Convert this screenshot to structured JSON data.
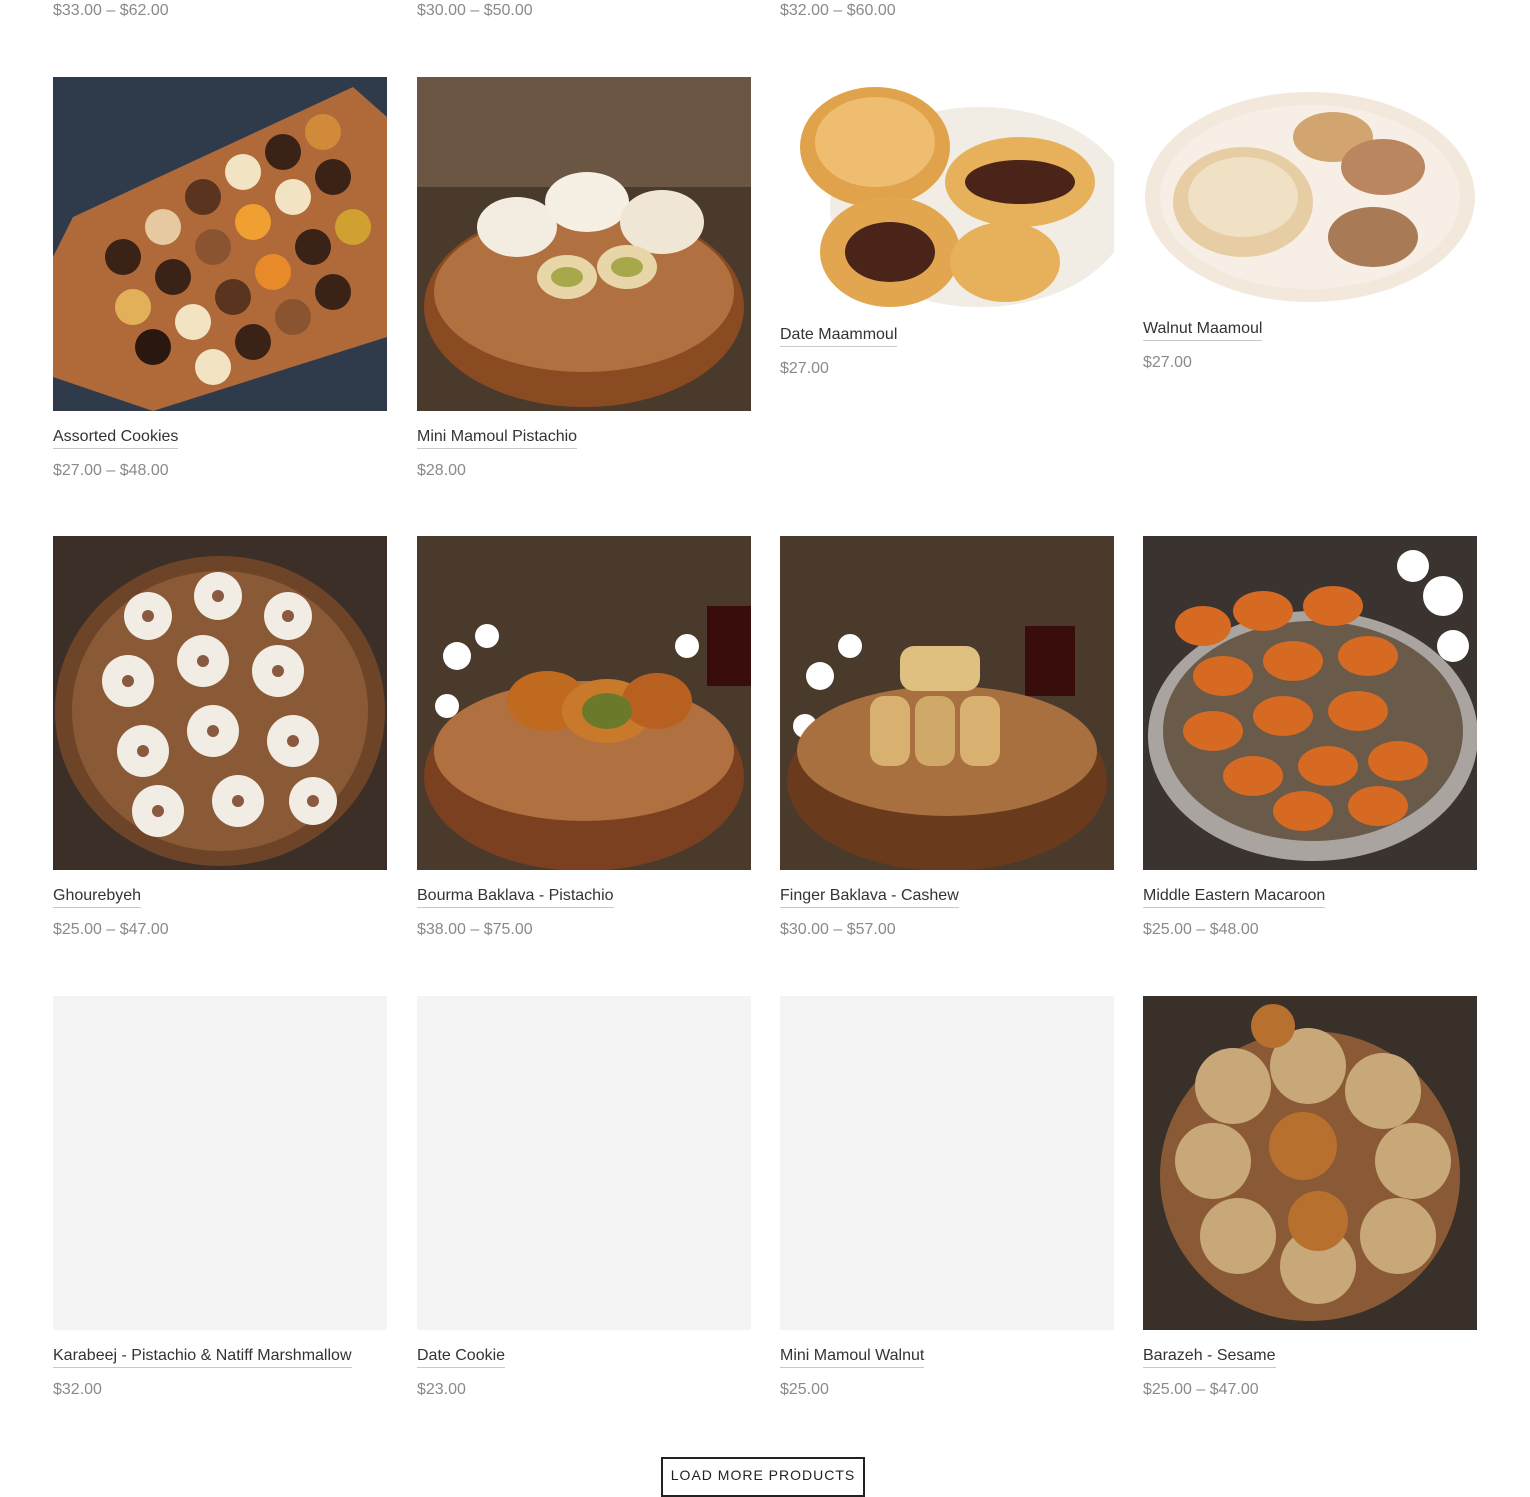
{
  "top_prices": [
    "$33.00 – $62.00",
    "$30.00 – $50.00",
    "$32.00 – $60.00"
  ],
  "products": [
    {
      "title": "Assorted Cookies",
      "price": "$27.00 – $48.00",
      "image": "assorted-cookies-image"
    },
    {
      "title": "Mini Mamoul Pistachio",
      "price": "$28.00",
      "image": "mini-mamoul-pistachio-image"
    },
    {
      "title": "Date Maammoul",
      "price": "$27.00",
      "image": "date-maammoul-image"
    },
    {
      "title": "Walnut Maamoul",
      "price": "$27.00",
      "image": "walnut-maamoul-image"
    },
    {
      "title": "Ghourebyeh",
      "price": "$25.00 – $47.00",
      "image": "ghourebyeh-image"
    },
    {
      "title": "Bourma Baklava - Pistachio",
      "price": "$38.00 – $75.00",
      "image": "bourma-baklava-image"
    },
    {
      "title": "Finger Baklava - Cashew",
      "price": "$30.00 – $57.00",
      "image": "finger-baklava-image"
    },
    {
      "title": "Middle Eastern Macaroon",
      "price": "$25.00 – $48.00",
      "image": "macaroon-image"
    },
    {
      "title": "Karabeej - Pistachio & Natiff Marshmallow",
      "price": "$32.00",
      "image": "placeholder-image"
    },
    {
      "title": "Date Cookie",
      "price": "$23.00",
      "image": "placeholder-image"
    },
    {
      "title": "Mini Mamoul Walnut",
      "price": "$25.00",
      "image": "placeholder-image"
    },
    {
      "title": "Barazeh - Sesame",
      "price": "$25.00 – $47.00",
      "image": "barazeh-sesame-image"
    }
  ],
  "load_more_label": "LOAD MORE PRODUCTS",
  "colors": {
    "price": "#8a8a8a",
    "title": "#333333",
    "placeholder": "#f4f4f4"
  }
}
